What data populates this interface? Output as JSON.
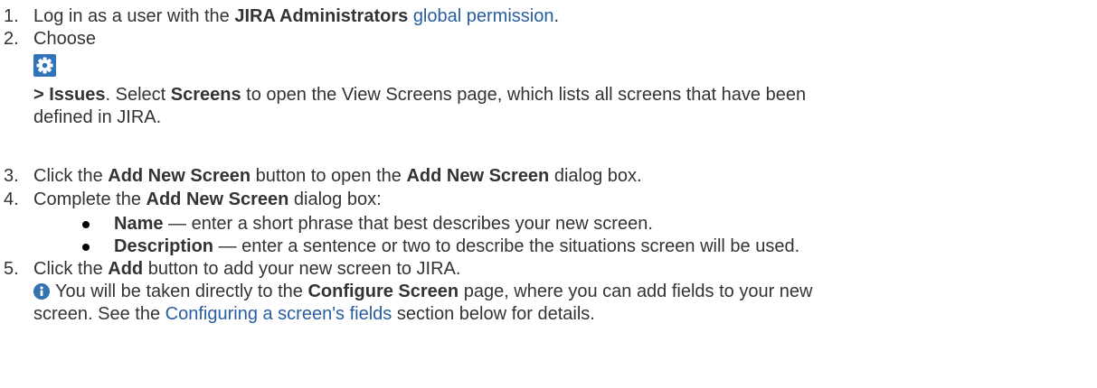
{
  "steps": [
    {
      "number": "1.",
      "pre": "Log in as a user with the ",
      "bold": "JIRA Administrators",
      "mid": " ",
      "link": "global permission",
      "post": "."
    },
    {
      "number": "2.",
      "choose": "Choose",
      "gear_icon": "gear-icon",
      "issues": "> Issues",
      "mid1": ". Select ",
      "screens": "Screens",
      "rest1": " to open the View Screens page, which lists all screens that have been",
      "rest2": "defined in JIRA."
    },
    {
      "number": "3.",
      "pre": "Click the ",
      "bold1": "Add New Screen",
      "mid": " button to open the ",
      "bold2": "Add New Screen",
      "post": " dialog box."
    },
    {
      "number": "4.",
      "pre": "Complete the ",
      "bold": "Add New Screen",
      "post": " dialog box:",
      "bullets": [
        {
          "term": "Name",
          "desc": " — enter a short phrase that best describes your new screen."
        },
        {
          "term": "Description",
          "desc": " — enter a sentence or two to describe the situations screen will be used."
        }
      ]
    },
    {
      "number": "5.",
      "pre": "Click the ",
      "bold": "Add",
      "post": " button to add your new screen to JIRA.",
      "info_icon": "info-icon",
      "note_pre": "You will be taken directly to the ",
      "note_bold": "Configure Screen",
      "note_post": " page, where you can add fields to your new",
      "note2_pre": "screen. See the ",
      "note2_link": "Configuring a screen's fields",
      "note2_post": " section below for details."
    }
  ],
  "colors": {
    "text": "#333333",
    "link": "#2a5d9f",
    "gear_bg": "#2f74b8",
    "info_bg": "#3572b0"
  }
}
